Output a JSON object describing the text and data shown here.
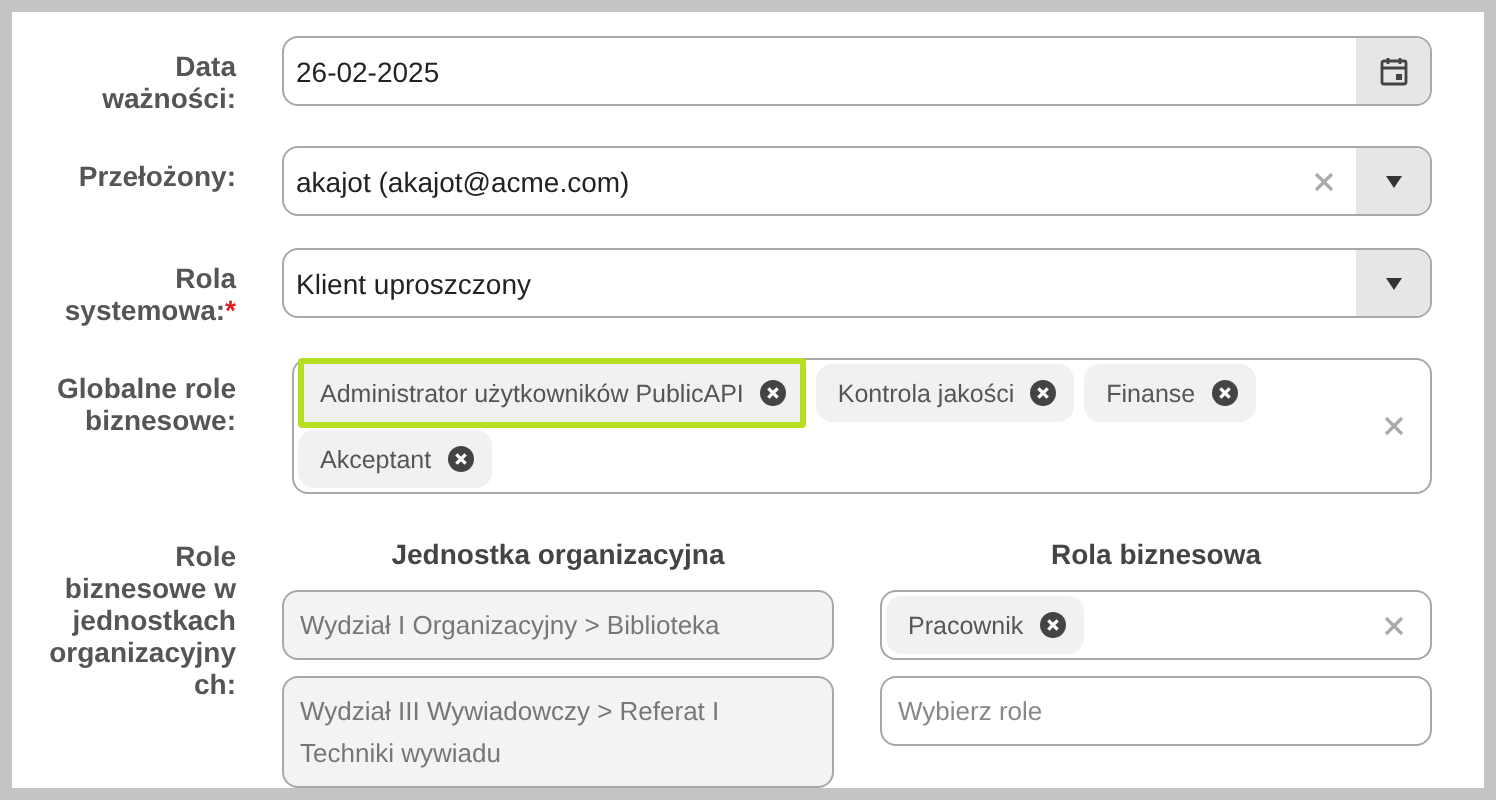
{
  "fields": [
    {
      "kind": "date",
      "label": "Data ważności:",
      "value": "26-02-2025"
    },
    {
      "kind": "select",
      "label": "Przełożony:",
      "value": "akajot (akajot@acme.com)",
      "clearable": true
    },
    {
      "kind": "select",
      "label": "Rola systemowa:",
      "required_mark": "*",
      "value": "Klient uproszczony",
      "clearable": false
    },
    {
      "kind": "tags",
      "label": "Globalne role biznesowe:",
      "clearable": true,
      "tags": [
        {
          "text": "Administrator użytkowników PublicAPI",
          "highlighted": true
        },
        {
          "text": "Kontrola jakości",
          "highlighted": false
        },
        {
          "text": "Finanse",
          "highlighted": false
        },
        {
          "text": "Akceptant",
          "highlighted": false
        }
      ]
    },
    {
      "kind": "unit_roles",
      "label": "Role biznesowe w jednostkach organizacyjnych:",
      "columns": [
        "Jednostka organizacyjna",
        "Rola biznesowa"
      ],
      "rows": [
        {
          "unit": "Wydział I Organizacyjny > Biblioteka",
          "roles": [
            {
              "text": "Pracownik"
            }
          ],
          "clearable": true
        },
        {
          "unit": "Wydział III Wywiadowczy > Referat I Techniki wywiadu",
          "placeholder": "Wybierz role"
        }
      ]
    }
  ]
}
